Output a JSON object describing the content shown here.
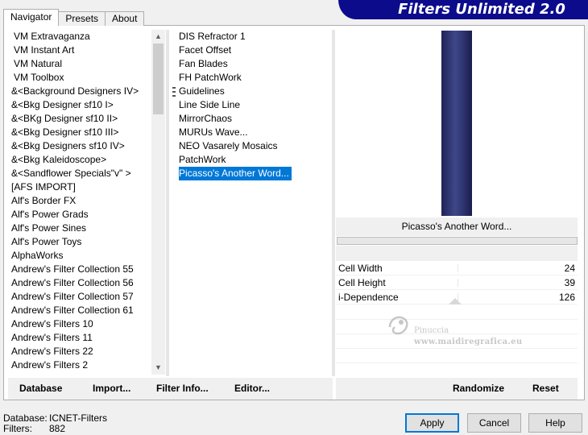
{
  "title": "Filters Unlimited 2.0",
  "tabs": [
    {
      "label": "Navigator"
    },
    {
      "label": "Presets"
    },
    {
      "label": "About"
    }
  ],
  "categories": [
    "VM Extravaganza",
    "VM Instant Art",
    "VM Natural",
    "VM Toolbox",
    "&<Background Designers IV>",
    "&<Bkg Designer sf10 I>",
    "&<BKg Designer sf10 II>",
    "&<Bkg Designer sf10 III>",
    "&<Bkg Designers sf10 IV>",
    "&<Bkg Kaleidoscope>",
    "&<Sandflower Specials\"v\" >",
    "[AFS IMPORT]",
    "Alf's Border FX",
    "Alf's Power Grads",
    "Alf's Power Sines",
    "Alf's Power Toys",
    "AlphaWorks",
    "Andrew's Filter Collection 55",
    "Andrew's Filter Collection 56",
    "Andrew's Filter Collection 57",
    "Andrew's Filter Collection 61",
    "Andrew's Filters 10",
    "Andrew's Filters 11",
    "Andrew's Filters 22",
    "Andrew's Filters 2"
  ],
  "filters": [
    "DIS Refractor 1",
    "Facet Offset",
    "Fan Blades",
    "FH PatchWork",
    "Guidelines",
    "Line Side Line",
    "MirrorChaos",
    "MURUs Wave...",
    "NEO Vasarely Mosaics",
    "PatchWork",
    "Picasso's Another Word..."
  ],
  "selected_filter": "Picasso's Another Word...",
  "preview": {
    "color": "#2f3572"
  },
  "params": [
    {
      "name": "Cell Width",
      "value": "24"
    },
    {
      "name": "Cell Height",
      "value": "39"
    },
    {
      "name": "i-Dependence",
      "value": "126"
    }
  ],
  "watermark": {
    "name": "Pinuccia",
    "site": "www.maidiregrafica.eu"
  },
  "footer": {
    "database": "Database",
    "import": "Import...",
    "filter_info": "Filter Info...",
    "editor": "Editor...",
    "randomize": "Randomize",
    "reset": "Reset"
  },
  "info": {
    "database_label": "Database:",
    "database_value": "ICNET-Filters",
    "filters_label": "Filters:",
    "filters_value": "882"
  },
  "buttons": {
    "apply": "Apply",
    "cancel": "Cancel",
    "help": "Help"
  }
}
